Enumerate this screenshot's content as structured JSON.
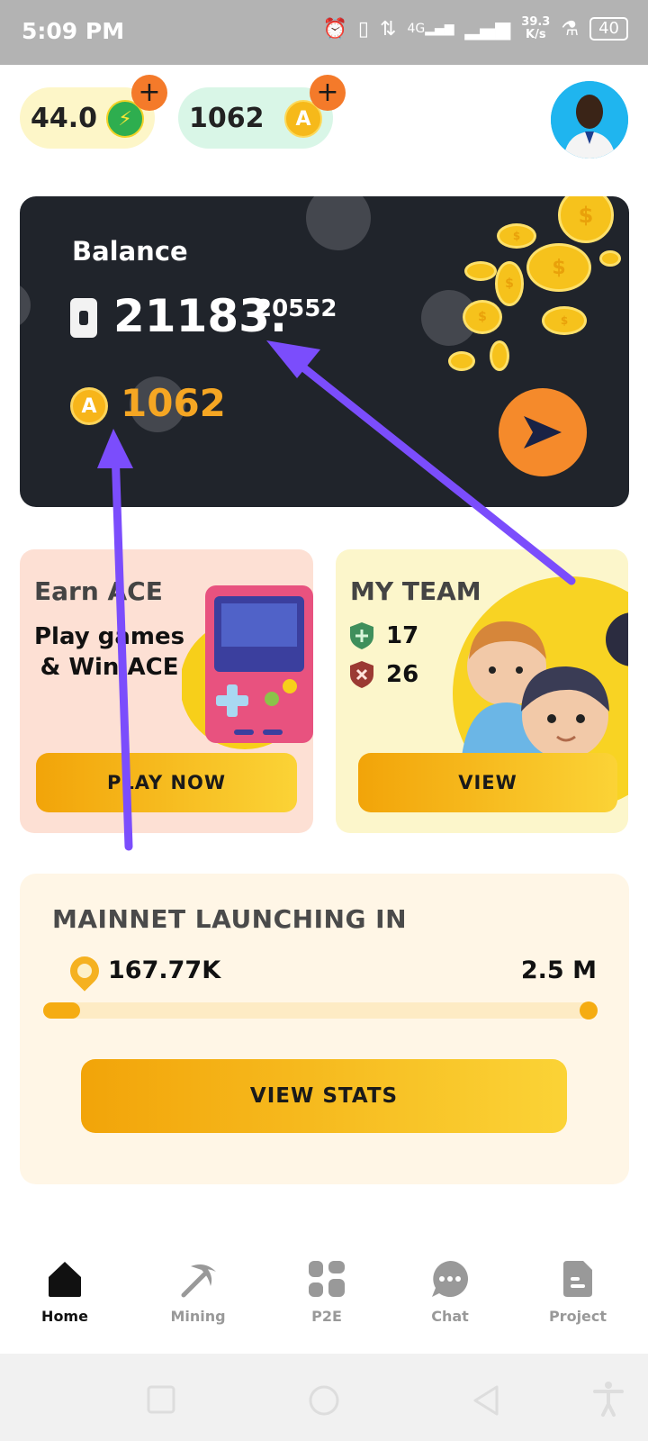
{
  "status_bar": {
    "time": "5:09 PM",
    "net_type": "4G",
    "speed_value": "39.3",
    "speed_unit": "K/s",
    "battery": "40"
  },
  "header": {
    "energy_value": "44.0",
    "coins_value": "1062",
    "energy_icon": "lightning-icon",
    "coin_icon": "ace-coin-icon",
    "add_label": "+"
  },
  "balance_card": {
    "title": "Balance",
    "balance_int": "21183.",
    "balance_frac": "20552",
    "coins": "1062",
    "coin_glyph": "A"
  },
  "earn_card": {
    "title": "Earn ACE",
    "subtitle_line1": "Play games",
    "subtitle_line2": "& Win ACE",
    "button": "PLAY NOW"
  },
  "team_card": {
    "title": "MY TEAM",
    "active_count": "17",
    "inactive_count": "26",
    "button": "VIEW"
  },
  "mainnet": {
    "title": "MAINNET LAUNCHING IN",
    "current": "167.77K",
    "target": "2.5 M",
    "progress_fraction": 0.067,
    "button": "VIEW STATS"
  },
  "bottom_nav": {
    "items": [
      {
        "label": "Home",
        "icon": "home-icon",
        "active": true
      },
      {
        "label": "Mining",
        "icon": "pickaxe-icon",
        "active": false
      },
      {
        "label": "P2E",
        "icon": "grid-icon",
        "active": false
      },
      {
        "label": "Chat",
        "icon": "chat-icon",
        "active": false
      },
      {
        "label": "Project",
        "icon": "document-icon",
        "active": false
      }
    ]
  },
  "colors": {
    "accent": "#f5ac12",
    "card_dark": "#20242b",
    "annotation_arrow": "#7b4dfc"
  }
}
